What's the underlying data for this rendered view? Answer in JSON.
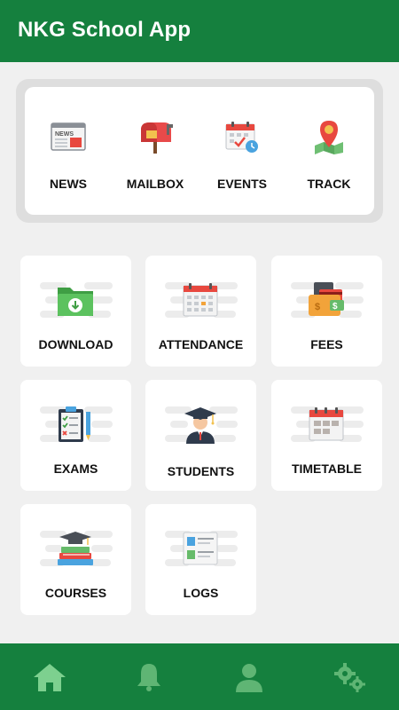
{
  "app": {
    "title": "NKG School App"
  },
  "top_menu": [
    {
      "label": "NEWS",
      "icon": "newspaper-icon"
    },
    {
      "label": "MAILBOX",
      "icon": "mailbox-icon"
    },
    {
      "label": "EVENTS",
      "icon": "calendar-events-icon"
    },
    {
      "label": "TRACK",
      "icon": "map-pin-icon"
    }
  ],
  "tiles": [
    {
      "label": "DOWNLOAD",
      "icon": "download-folder-icon"
    },
    {
      "label": "ATTENDANCE",
      "icon": "attendance-calendar-icon"
    },
    {
      "label": "FEES",
      "icon": "wallet-icon"
    },
    {
      "label": "EXAMS",
      "icon": "exam-clipboard-icon"
    },
    {
      "label": "STUDENTS",
      "icon": "graduate-student-icon"
    },
    {
      "label": "TIMETABLE",
      "icon": "timetable-calendar-icon"
    },
    {
      "label": "COURSES",
      "icon": "books-graduation-cap-icon"
    },
    {
      "label": "LOGS",
      "icon": "logs-document-icon"
    }
  ],
  "bottom_nav": [
    {
      "name": "home",
      "icon": "home-icon",
      "active": true
    },
    {
      "name": "notifications",
      "icon": "bell-icon",
      "active": false
    },
    {
      "name": "profile",
      "icon": "user-icon",
      "active": false
    },
    {
      "name": "settings",
      "icon": "gears-icon",
      "active": false
    }
  ],
  "colors": {
    "primary": "#15803e",
    "nav_active": "#7dd08f",
    "nav_inactive": "#5fb574"
  }
}
